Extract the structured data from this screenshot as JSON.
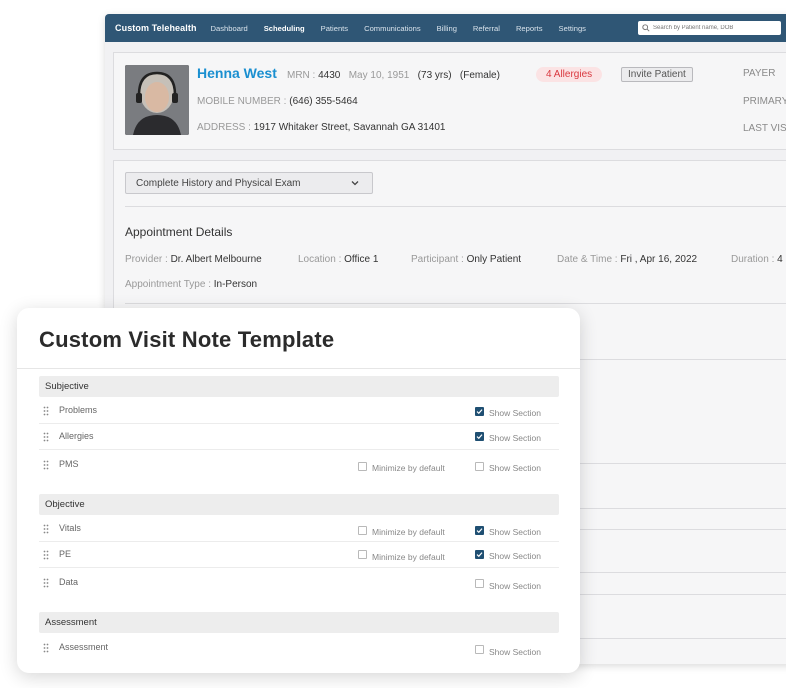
{
  "nav": {
    "brand": "Custom Telehealth",
    "items": [
      "Dashboard",
      "Scheduling",
      "Patients",
      "Communications",
      "Billing",
      "Referral",
      "Reports",
      "Settings"
    ],
    "search_placeholder": "Search by Patient name, DOB"
  },
  "patient": {
    "name": "Henna West",
    "mrn_label": "MRN :",
    "mrn": "4430",
    "dob": "May 10, 1951",
    "age": "(73 yrs)",
    "sex": "(Female)",
    "allergies_badge": "4  Allergies",
    "invite_label": "Invite Patient",
    "mobile_label": "MOBILE NUMBER :",
    "mobile": "(646) 355-5464",
    "address_label": "ADDRESS :",
    "address": "1917 Whitaker Street, Savannah GA 31401",
    "right_labels": [
      "PAYER",
      "PRIMARY",
      "LAST VIS"
    ]
  },
  "exam": {
    "selected": "Complete History and Physical Exam"
  },
  "appointment": {
    "title": "Appointment Details",
    "provider_label": "Provider :",
    "provider": "Dr. Albert Melbourne",
    "location_label": "Location :",
    "location": "Office 1",
    "participant_label": "Participant :",
    "participant": "Only Patient",
    "datetime_label": "Date & Time :",
    "datetime": "Fri , Apr 16, 2022",
    "duration_label": "Duration :",
    "duration": "4",
    "type_label": "Appointment Type :",
    "type": "In-Person"
  },
  "modal": {
    "title": "Custom Visit Note Template",
    "minimize_label": "Minimize by default",
    "show_label": "Show Section",
    "sections": [
      {
        "name": "Subjective",
        "items": [
          {
            "label": "Problems",
            "minimize": null,
            "show": true
          },
          {
            "label": "Allergies",
            "minimize": null,
            "show": true
          },
          {
            "label": "PMS",
            "minimize": false,
            "show": false
          }
        ]
      },
      {
        "name": "Objective",
        "items": [
          {
            "label": "Vitals",
            "minimize": false,
            "show": true
          },
          {
            "label": "PE",
            "minimize": false,
            "show": true
          },
          {
            "label": "Data",
            "minimize": null,
            "show": false
          }
        ]
      },
      {
        "name": "Assessment",
        "items": [
          {
            "label": "Assessment",
            "minimize": null,
            "show": false
          }
        ]
      }
    ]
  },
  "colors": {
    "nav_bg": "#2f5675",
    "accent_blue": "#1a8fd0",
    "checkbox_on": "#1f4f72",
    "allergy_red": "#d9383f"
  }
}
